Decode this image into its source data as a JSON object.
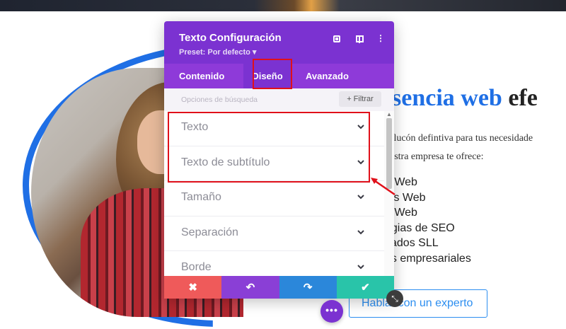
{
  "panel": {
    "title": "Texto Configuración",
    "preset": "Preset: Por defecto ▾",
    "header_icons": [
      "target-icon",
      "columns-icon",
      "more-vertical-icon"
    ],
    "tabs": [
      {
        "label": "Contenido",
        "active": false
      },
      {
        "label": "Diseño",
        "active": true
      },
      {
        "label": "Avanzado",
        "active": false
      }
    ],
    "search": {
      "placeholder": "Opciones de búsqueda",
      "value": ""
    },
    "filter_label": "+ Filtrar",
    "sections": [
      {
        "label": "Texto",
        "highlighted": true
      },
      {
        "label": "Texto de subtítulo",
        "highlighted": true
      },
      {
        "label": "Tamaño",
        "highlighted": false
      },
      {
        "label": "Separación",
        "highlighted": false
      },
      {
        "label": "Borde",
        "highlighted": false
      }
    ],
    "footer": {
      "discard": "✖",
      "undo": "↶",
      "redo": "↷",
      "save": "✔"
    }
  },
  "page": {
    "headline_blue": "sencia web",
    "headline_dark": "efe",
    "paragraph_line1": "solucón defintiva para tus necesidade",
    "paragraph_line2": "uestra empresa te ofrece:",
    "bullets": [
      "g Web",
      "ios Web",
      "o Web",
      "egias de SEO",
      "cados SLL",
      "os empresariales"
    ],
    "cta_label": "Hablar con un experto",
    "more_button": "•••"
  },
  "colors": {
    "panel_purple": "#7b32d1",
    "tab_purple": "#8e3ad9",
    "accent_blue": "#1f6fe5",
    "highlight_red": "#e0101a",
    "discard_red": "#ef5a5a",
    "redo_blue": "#2b87da",
    "save_green": "#29c4a9"
  }
}
